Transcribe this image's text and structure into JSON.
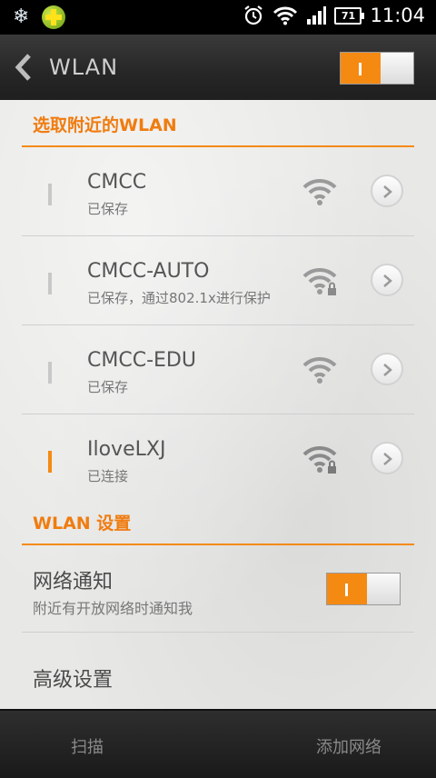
{
  "status_bar": {
    "time": "11:04",
    "battery": "71",
    "left_icons": [
      "snowflake-icon",
      "plus-badge-icon"
    ],
    "right_icons": [
      "alarm-icon",
      "wifi-icon",
      "signal-icon",
      "battery-icon"
    ]
  },
  "action_bar": {
    "title": "WLAN",
    "toggle_state": "on"
  },
  "nearby_section": {
    "header": "选取附近的WLAN",
    "networks": [
      {
        "name": "CMCC",
        "status": "已保存",
        "secured": false,
        "active": false
      },
      {
        "name": "CMCC-AUTO",
        "status": "已保存，通过802.1x进行保护",
        "secured": true,
        "active": false
      },
      {
        "name": "CMCC-EDU",
        "status": "已保存",
        "secured": false,
        "active": false
      },
      {
        "name": "IloveLXJ",
        "status": "已连接",
        "secured": true,
        "active": true
      }
    ]
  },
  "settings_section": {
    "header": "WLAN 设置",
    "network_notify": {
      "title": "网络通知",
      "subtitle": "附近有开放网络时通知我",
      "toggle_state": "on"
    },
    "advanced": {
      "title": "高级设置"
    }
  },
  "bottom_bar": {
    "scan_label": "扫描",
    "add_network_label": "添加网络"
  },
  "colors": {
    "accent": "#f58a13",
    "header_text": "#f07c10"
  }
}
